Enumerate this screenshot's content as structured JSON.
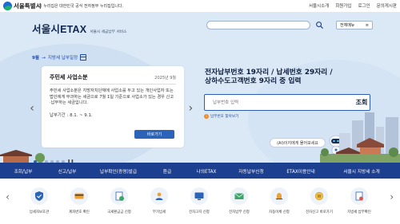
{
  "topbar": {
    "logo_text": "서울특별시",
    "notice": "이 누리집은 대한민국 공식 전자정부 누리집입니다.",
    "links": [
      "서울시소개",
      "회원가입",
      "로그인",
      "문의게시판"
    ]
  },
  "header": {
    "brand": "서울시ETAX",
    "brand_sub": "서울시 세금납부 서비스",
    "menu_label": "전체메뉴"
  },
  "month": {
    "badge": "9월",
    "label": "지방세 납부일정"
  },
  "card": {
    "title": "주민세 사업소분",
    "date": "2025년 9월",
    "body": "주민세 사업소분은 지방자치단체에 사업소를 두고 있는 개인사업자 또는 법인에게 부과하는 세금으로 7월 1일 기준으로 사업소가 있는 경우 신고·납부하는 세금입니다.",
    "period": "납부기간 : 8.1. ~ 9.1.",
    "button": "바로가기"
  },
  "payment": {
    "heading_line1": "전자납부번호 19자리 / 납세번호 29자리 /",
    "heading_line2": "상하수도고객번호 9자리 중 입력",
    "placeholder": "납부번호 입력",
    "button": "조회",
    "help": "납부번호 찾아보기"
  },
  "chatbot": {
    "label": "(AI)이지에게 물어보세요"
  },
  "nav": {
    "items": [
      "조회/납부",
      "신고/납부",
      "납부확인(증명)발급",
      "환급",
      "나의ETAX",
      "자동납부신청",
      "ETAX이용안내",
      "서울시 지방세 소개"
    ]
  },
  "quick": {
    "items": [
      {
        "label": "납세자보호관",
        "icon": "shield-icon"
      },
      {
        "label": "계좌번호 확인",
        "icon": "card-icon"
      },
      {
        "label": "국세환급금 신청",
        "icon": "refund-icon"
      },
      {
        "label": "부가납세",
        "icon": "person-icon"
      },
      {
        "label": "전자고지 신청",
        "icon": "monitor-icon"
      },
      {
        "label": "전자납부 신청",
        "icon": "mail-icon"
      },
      {
        "label": "자동이체 신청",
        "icon": "bell-icon"
      },
      {
        "label": "전자신고 바로가기",
        "icon": "coin-icon"
      },
      {
        "label": "지방세 납부확인",
        "icon": "document-icon"
      }
    ]
  },
  "colors": {
    "navy": "#1d3f8f",
    "hero_bg": "#dbe8f6",
    "accent_blue": "#2a63b8"
  }
}
